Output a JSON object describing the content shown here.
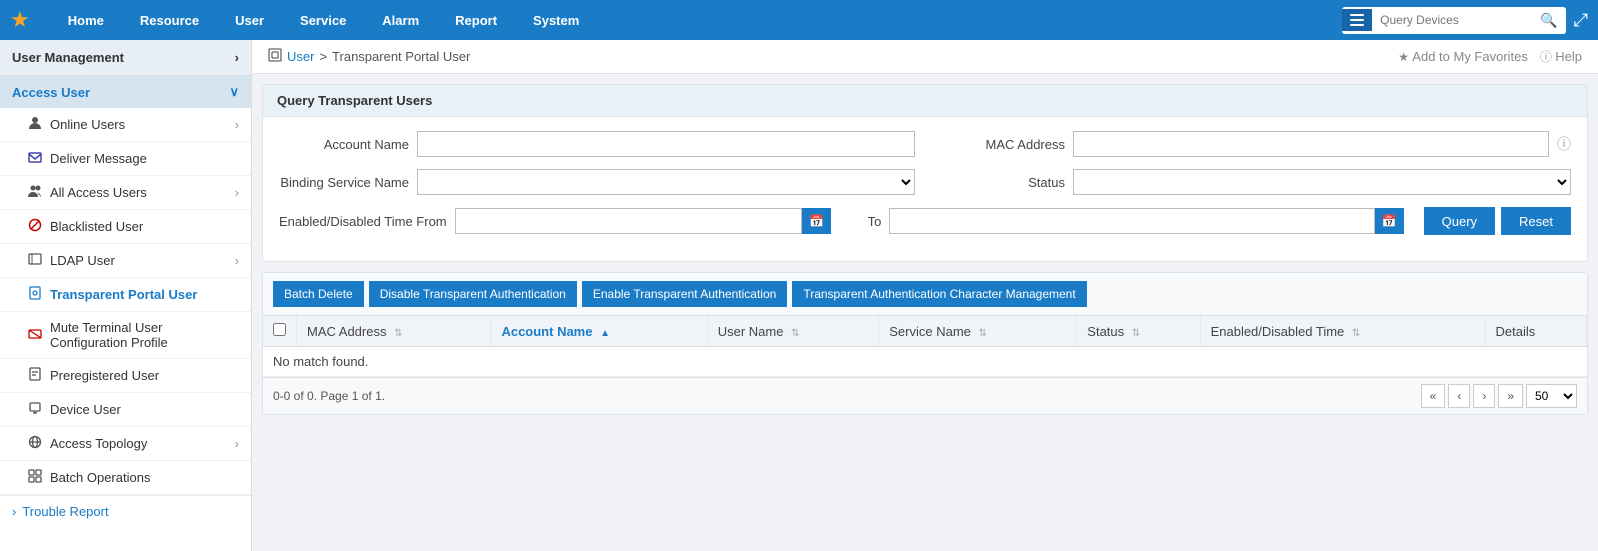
{
  "nav": {
    "logo": "★",
    "items": [
      {
        "label": "Home"
      },
      {
        "label": "Resource"
      },
      {
        "label": "User"
      },
      {
        "label": "Service"
      },
      {
        "label": "Alarm"
      },
      {
        "label": "Report"
      },
      {
        "label": "System"
      }
    ],
    "search_placeholder": "Query Devices"
  },
  "sidebar": {
    "header_label": "User Management",
    "collapse_icon": "›",
    "access_user_label": "Access User",
    "items": [
      {
        "label": "Online Users",
        "icon": "👤",
        "has_arrow": true
      },
      {
        "label": "Deliver Message",
        "icon": "✉"
      },
      {
        "label": "All Access Users",
        "icon": "👥",
        "has_arrow": true
      },
      {
        "label": "Blacklisted User",
        "icon": "🚫"
      },
      {
        "label": "LDAP User",
        "icon": "📋",
        "has_arrow": true
      },
      {
        "label": "Transparent Portal User",
        "icon": "🔒",
        "active": true
      },
      {
        "label": "Mute Terminal User Configuration Profile",
        "icon": "🔇"
      },
      {
        "label": "Preregistered User",
        "icon": "📝"
      },
      {
        "label": "Device User",
        "icon": "💻"
      },
      {
        "label": "Access Topology",
        "icon": "🌐",
        "has_arrow": true
      },
      {
        "label": "Batch Operations",
        "icon": "📦"
      }
    ],
    "footer_label": "Trouble Report"
  },
  "breadcrumb": {
    "icon": "🔲",
    "parent_label": "User",
    "separator": ">",
    "current_label": "Transparent Portal User",
    "favorites_label": "Add to My Favorites",
    "help_label": "Help"
  },
  "query_panel": {
    "title": "Query Transparent Users",
    "fields": {
      "account_name_label": "Account Name",
      "account_name_placeholder": "",
      "mac_address_label": "MAC Address",
      "mac_address_placeholder": "",
      "binding_service_label": "Binding Service Name",
      "status_label": "Status",
      "time_from_label": "Enabled/Disabled Time From",
      "time_to_label": "To"
    },
    "buttons": {
      "query_label": "Query",
      "reset_label": "Reset"
    }
  },
  "toolbar": {
    "batch_delete_label": "Batch Delete",
    "disable_auth_label": "Disable Transparent Authentication",
    "enable_auth_label": "Enable Transparent Authentication",
    "char_mgmt_label": "Transparent Authentication Character Management"
  },
  "table": {
    "columns": [
      {
        "label": "MAC Address",
        "sort": "neutral"
      },
      {
        "label": "Account Name",
        "sort": "asc",
        "sorted": true
      },
      {
        "label": "User Name",
        "sort": "neutral"
      },
      {
        "label": "Service Name",
        "sort": "neutral"
      },
      {
        "label": "Status",
        "sort": "neutral"
      },
      {
        "label": "Enabled/Disabled Time",
        "sort": "neutral"
      },
      {
        "label": "Details"
      }
    ],
    "no_match_text": "No match found.",
    "pagination": {
      "info": "0-0 of 0. Page 1 of 1.",
      "per_page": "50"
    }
  }
}
